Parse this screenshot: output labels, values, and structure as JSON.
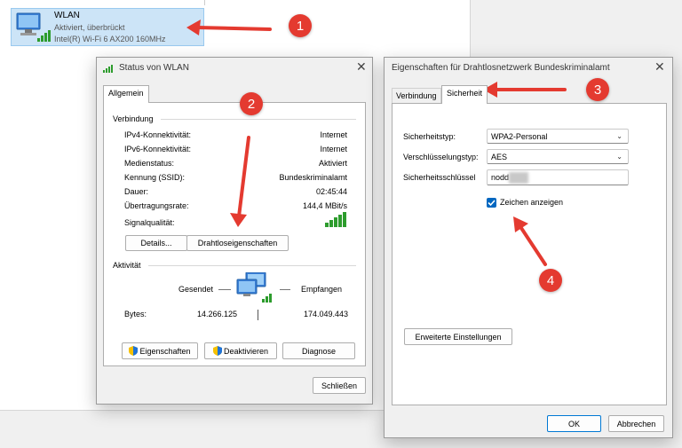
{
  "explorer": {
    "wlan_name": "WLAN",
    "wlan_status": "Aktiviert, überbrückt",
    "wlan_adapter": "Intel(R) Wi-Fi 6 AX200 160MHz"
  },
  "status_dialog": {
    "title": "Status von WLAN",
    "tab": "Allgemein",
    "section_connection": "Verbindung",
    "rows": [
      {
        "label": "IPv4-Konnektivität:",
        "value": "Internet"
      },
      {
        "label": "IPv6-Konnektivität:",
        "value": "Internet"
      },
      {
        "label": "Medienstatus:",
        "value": "Aktiviert"
      },
      {
        "label": "Kennung (SSID):",
        "value": "Bundeskriminalamt"
      },
      {
        "label": "Dauer:",
        "value": "02:45:44"
      },
      {
        "label": "Übertragungsrate:",
        "value": "144,4 MBit/s"
      }
    ],
    "signal_label": "Signalqualität:",
    "details_button": "Details...",
    "wireless_props_button": "Drahtloseigenschaften",
    "section_activity": "Aktivität",
    "sent_label": "Gesendet",
    "received_label": "Empfangen",
    "bytes_label": "Bytes:",
    "bytes_sent": "14.266.125",
    "bytes_received": "174.049.443",
    "properties_button": "Eigenschaften",
    "deactivate_button": "Deaktivieren",
    "diagnose_button": "Diagnose",
    "close_button": "Schließen"
  },
  "props_dialog": {
    "title": "Eigenschaften für Drahtlosnetzwerk Bundeskriminalamt",
    "tabs": [
      "Verbindung",
      "Sicherheit"
    ],
    "security_type_label": "Sicherheitstyp:",
    "security_type_value": "WPA2-Personal",
    "encryption_label": "Verschlüsselungstyp:",
    "encryption_value": "AES",
    "key_label": "Sicherheitsschlüssel",
    "key_value": "nodd",
    "show_chars_label": "Zeichen anzeigen",
    "show_chars_checked": true,
    "advanced_button": "Erweiterte Einstellungen",
    "ok_button": "OK",
    "cancel_button": "Abbrechen"
  },
  "annotations": [
    "1",
    "2",
    "3",
    "4"
  ],
  "colors": {
    "annotation_red": "#e43a30",
    "selection_blue": "#cce4f7",
    "signal_green": "#2d9c2d",
    "accent": "#0078d4"
  },
  "icons": [
    "network-adapter-icon",
    "signal-bars-icon",
    "close-icon",
    "chevron-down-icon",
    "uac-shield-icon",
    "network-computers-icon",
    "checkbox-checked-icon"
  ]
}
